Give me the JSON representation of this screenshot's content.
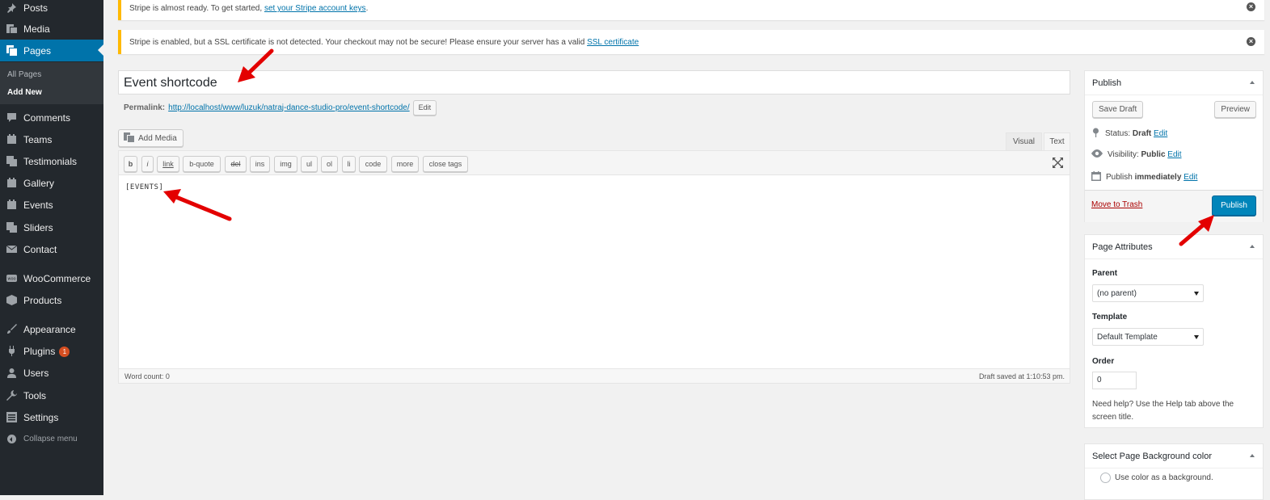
{
  "sidebar": {
    "items": [
      {
        "label": "Posts",
        "icon": "pushpin-icon"
      },
      {
        "label": "Media",
        "icon": "media-icon"
      },
      {
        "label": "Pages",
        "icon": "pages-icon"
      },
      {
        "label": "Comments",
        "icon": "comments-icon"
      },
      {
        "label": "Teams",
        "icon": "teams-icon"
      },
      {
        "label": "Testimonials",
        "icon": "testimonials-icon"
      },
      {
        "label": "Gallery",
        "icon": "gallery-icon"
      },
      {
        "label": "Events",
        "icon": "events-icon"
      },
      {
        "label": "Sliders",
        "icon": "sliders-icon"
      },
      {
        "label": "Contact",
        "icon": "mail-icon"
      },
      {
        "label": "WooCommerce",
        "icon": "woocommerce-icon"
      },
      {
        "label": "Products",
        "icon": "products-icon"
      },
      {
        "label": "Appearance",
        "icon": "paintbrush-icon"
      },
      {
        "label": "Plugins",
        "icon": "plugins-icon",
        "badge": "1"
      },
      {
        "label": "Users",
        "icon": "users-icon"
      },
      {
        "label": "Tools",
        "icon": "tools-icon"
      },
      {
        "label": "Settings",
        "icon": "settings-icon"
      }
    ],
    "submenu": [
      "All Pages",
      "Add New"
    ],
    "collapse_label": "Collapse menu"
  },
  "notices": {
    "n1_text": "Stripe is almost ready. To get started, ",
    "n1_link": "set your Stripe account keys",
    "n1_end": ".",
    "n2_text": "Stripe is enabled, but a SSL certificate is not detected. Your checkout may not be secure! Please ensure your server has a valid ",
    "n2_link": "SSL certificate",
    "dismiss": "×"
  },
  "editor": {
    "title": "Event shortcode",
    "permalink_label": "Permalink:",
    "permalink_url": "http://localhost/www/luzuk/natraj-dance-studio-pro/event-shortcode/",
    "edit_label": "Edit",
    "add_media_label": "Add Media",
    "tab_visual": "Visual",
    "tab_text": "Text",
    "qt_buttons": [
      "b",
      "i",
      "link",
      "b-quote",
      "del",
      "ins",
      "img",
      "ul",
      "ol",
      "li",
      "code",
      "more",
      "close tags"
    ],
    "content": "[EVENTS]",
    "word_count": "Word count: 0",
    "draft_saved": "Draft saved at 1:10:53 pm."
  },
  "publish": {
    "heading": "Publish",
    "save_draft": "Save Draft",
    "preview": "Preview",
    "status_label": "Status:",
    "status_value": "Draft",
    "visibility_label": "Visibility:",
    "visibility_value": "Public",
    "publish_label": "Publish",
    "publish_value": "immediately",
    "edit": "Edit",
    "trash": "Move to Trash",
    "publish_button": "Publish"
  },
  "page_attributes": {
    "heading": "Page Attributes",
    "parent_label": "Parent",
    "parent_value": "(no parent)",
    "template_label": "Template",
    "template_value": "Default Template",
    "order_label": "Order",
    "order_value": "0",
    "help_text": "Need help? Use the Help tab above the screen title."
  },
  "bg_color": {
    "heading": "Select Page Background color",
    "option": "Use color as a background."
  },
  "colors": {
    "sidebar": "#23282d",
    "accent": "#0073aa",
    "publish_button": "#0085ba",
    "notice_border": "#ffb900",
    "arrow": "#e30000"
  }
}
